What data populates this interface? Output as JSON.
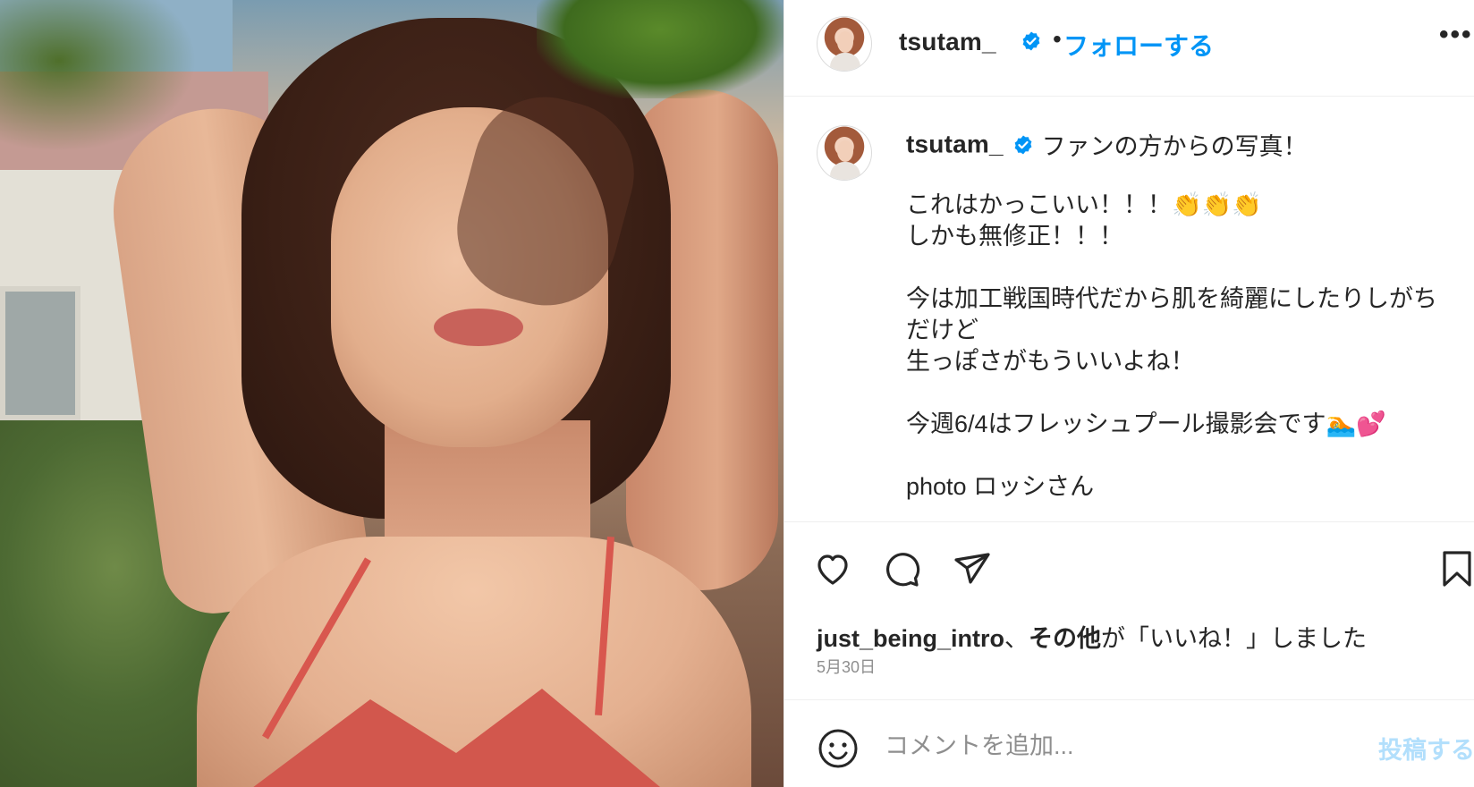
{
  "colors": {
    "link_blue": "#0095f6",
    "verified_blue": "#0095f6",
    "post_disabled": "#b2dffc",
    "text_primary": "#262626",
    "text_secondary": "#8e8e8e"
  },
  "photo": {
    "icon": "post-image"
  },
  "header": {
    "username": "tsutam_",
    "separator": "•",
    "follow_label": "フォローする",
    "more_label": "•••"
  },
  "caption": {
    "username": "tsutam_",
    "first_line": "ファンの方からの写真！",
    "lines": [
      "",
      "これはかっこいい！！！👏👏👏",
      "しかも無修正！！！",
      "",
      "今は加工戦国時代だから肌を綺麗にしたりしがちだけど",
      "生っぽさがもういいよね！",
      "",
      "今週6/4はフレッシュプール撮影会です🏊💕",
      "",
      "photo ロッシさん"
    ]
  },
  "actions": {
    "icons": [
      "heart-icon",
      "comment-icon",
      "share-icon",
      "bookmark-icon"
    ]
  },
  "likes": {
    "user": "just_being_intro",
    "sep": "、",
    "others": "その他",
    "suffix": "が「いいね！」しました"
  },
  "date": "5月30日",
  "comment": {
    "placeholder": "コメントを追加...",
    "post_label": "投稿する",
    "emoji_icon": "smiley-icon"
  }
}
